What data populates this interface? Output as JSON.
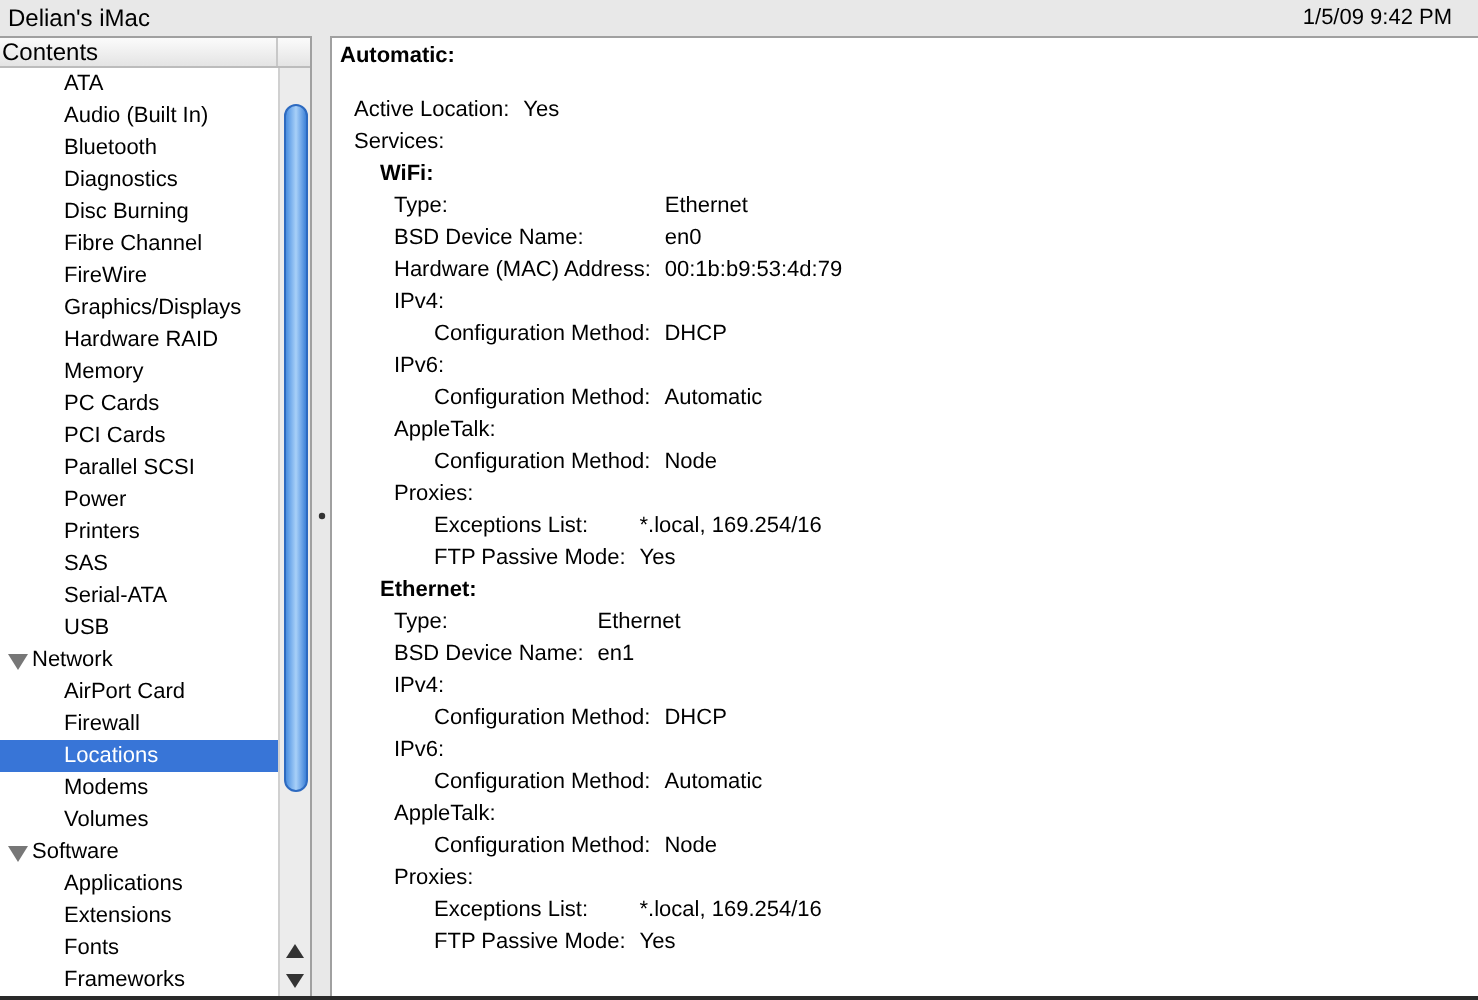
{
  "window": {
    "title": "Delian's iMac",
    "datetime": "1/5/09 9:42 PM"
  },
  "sidebar": {
    "header": "Contents",
    "items": [
      {
        "label": "ATA",
        "selected": false
      },
      {
        "label": "Audio (Built In)",
        "selected": false
      },
      {
        "label": "Bluetooth",
        "selected": false
      },
      {
        "label": "Diagnostics",
        "selected": false
      },
      {
        "label": "Disc Burning",
        "selected": false
      },
      {
        "label": "Fibre Channel",
        "selected": false
      },
      {
        "label": "FireWire",
        "selected": false
      },
      {
        "label": "Graphics/Displays",
        "selected": false
      },
      {
        "label": "Hardware RAID",
        "selected": false
      },
      {
        "label": "Memory",
        "selected": false
      },
      {
        "label": "PC Cards",
        "selected": false
      },
      {
        "label": "PCI Cards",
        "selected": false
      },
      {
        "label": "Parallel SCSI",
        "selected": false
      },
      {
        "label": "Power",
        "selected": false
      },
      {
        "label": "Printers",
        "selected": false
      },
      {
        "label": "SAS",
        "selected": false
      },
      {
        "label": "Serial-ATA",
        "selected": false
      },
      {
        "label": "USB",
        "selected": false
      },
      {
        "label": "Network",
        "selected": false,
        "expanded": true,
        "children": [
          {
            "label": "AirPort Card",
            "selected": false
          },
          {
            "label": "Firewall",
            "selected": false
          },
          {
            "label": "Locations",
            "selected": true
          },
          {
            "label": "Modems",
            "selected": false
          },
          {
            "label": "Volumes",
            "selected": false
          }
        ]
      },
      {
        "label": "Software",
        "selected": false,
        "expanded": true,
        "children": [
          {
            "label": "Applications",
            "selected": false
          },
          {
            "label": "Extensions",
            "selected": false
          },
          {
            "label": "Fonts",
            "selected": false
          },
          {
            "label": "Frameworks",
            "selected": false
          }
        ]
      }
    ]
  },
  "detail": {
    "title": "Automatic:",
    "fields": [
      {
        "label": "Active Location:",
        "value": "Yes"
      }
    ],
    "services_label": "Services:",
    "services": [
      {
        "name": "WiFi:",
        "fields": [
          {
            "label": "Type:",
            "value": "Ethernet"
          },
          {
            "label": "BSD Device Name:",
            "value": "en0"
          },
          {
            "label": "Hardware (MAC) Address:",
            "value": "00:1b:b9:53:4d:79"
          }
        ],
        "sections": [
          {
            "name": "IPv4:",
            "fields": [
              {
                "label": "Configuration Method:",
                "value": "DHCP"
              }
            ]
          },
          {
            "name": "IPv6:",
            "fields": [
              {
                "label": "Configuration Method:",
                "value": "Automatic"
              }
            ]
          },
          {
            "name": "AppleTalk:",
            "fields": [
              {
                "label": "Configuration Method:",
                "value": "Node"
              }
            ]
          },
          {
            "name": "Proxies:",
            "fields": [
              {
                "label": "Exceptions List:",
                "value": "*.local, 169.254/16"
              },
              {
                "label": "FTP Passive Mode:",
                "value": "Yes"
              }
            ]
          }
        ]
      },
      {
        "name": "Ethernet:",
        "fields": [
          {
            "label": "Type:",
            "value": "Ethernet"
          },
          {
            "label": "BSD Device Name:",
            "value": "en1"
          }
        ],
        "sections": [
          {
            "name": "IPv4:",
            "fields": [
              {
                "label": "Configuration Method:",
                "value": "DHCP"
              }
            ]
          },
          {
            "name": "IPv6:",
            "fields": [
              {
                "label": "Configuration Method:",
                "value": "Automatic"
              }
            ]
          },
          {
            "name": "AppleTalk:",
            "fields": [
              {
                "label": "Configuration Method:",
                "value": "Node"
              }
            ]
          },
          {
            "name": "Proxies:",
            "fields": [
              {
                "label": "Exceptions List:",
                "value": "*.local, 169.254/16"
              },
              {
                "label": "FTP Passive Mode:",
                "value": "Yes"
              }
            ]
          }
        ]
      }
    ]
  }
}
